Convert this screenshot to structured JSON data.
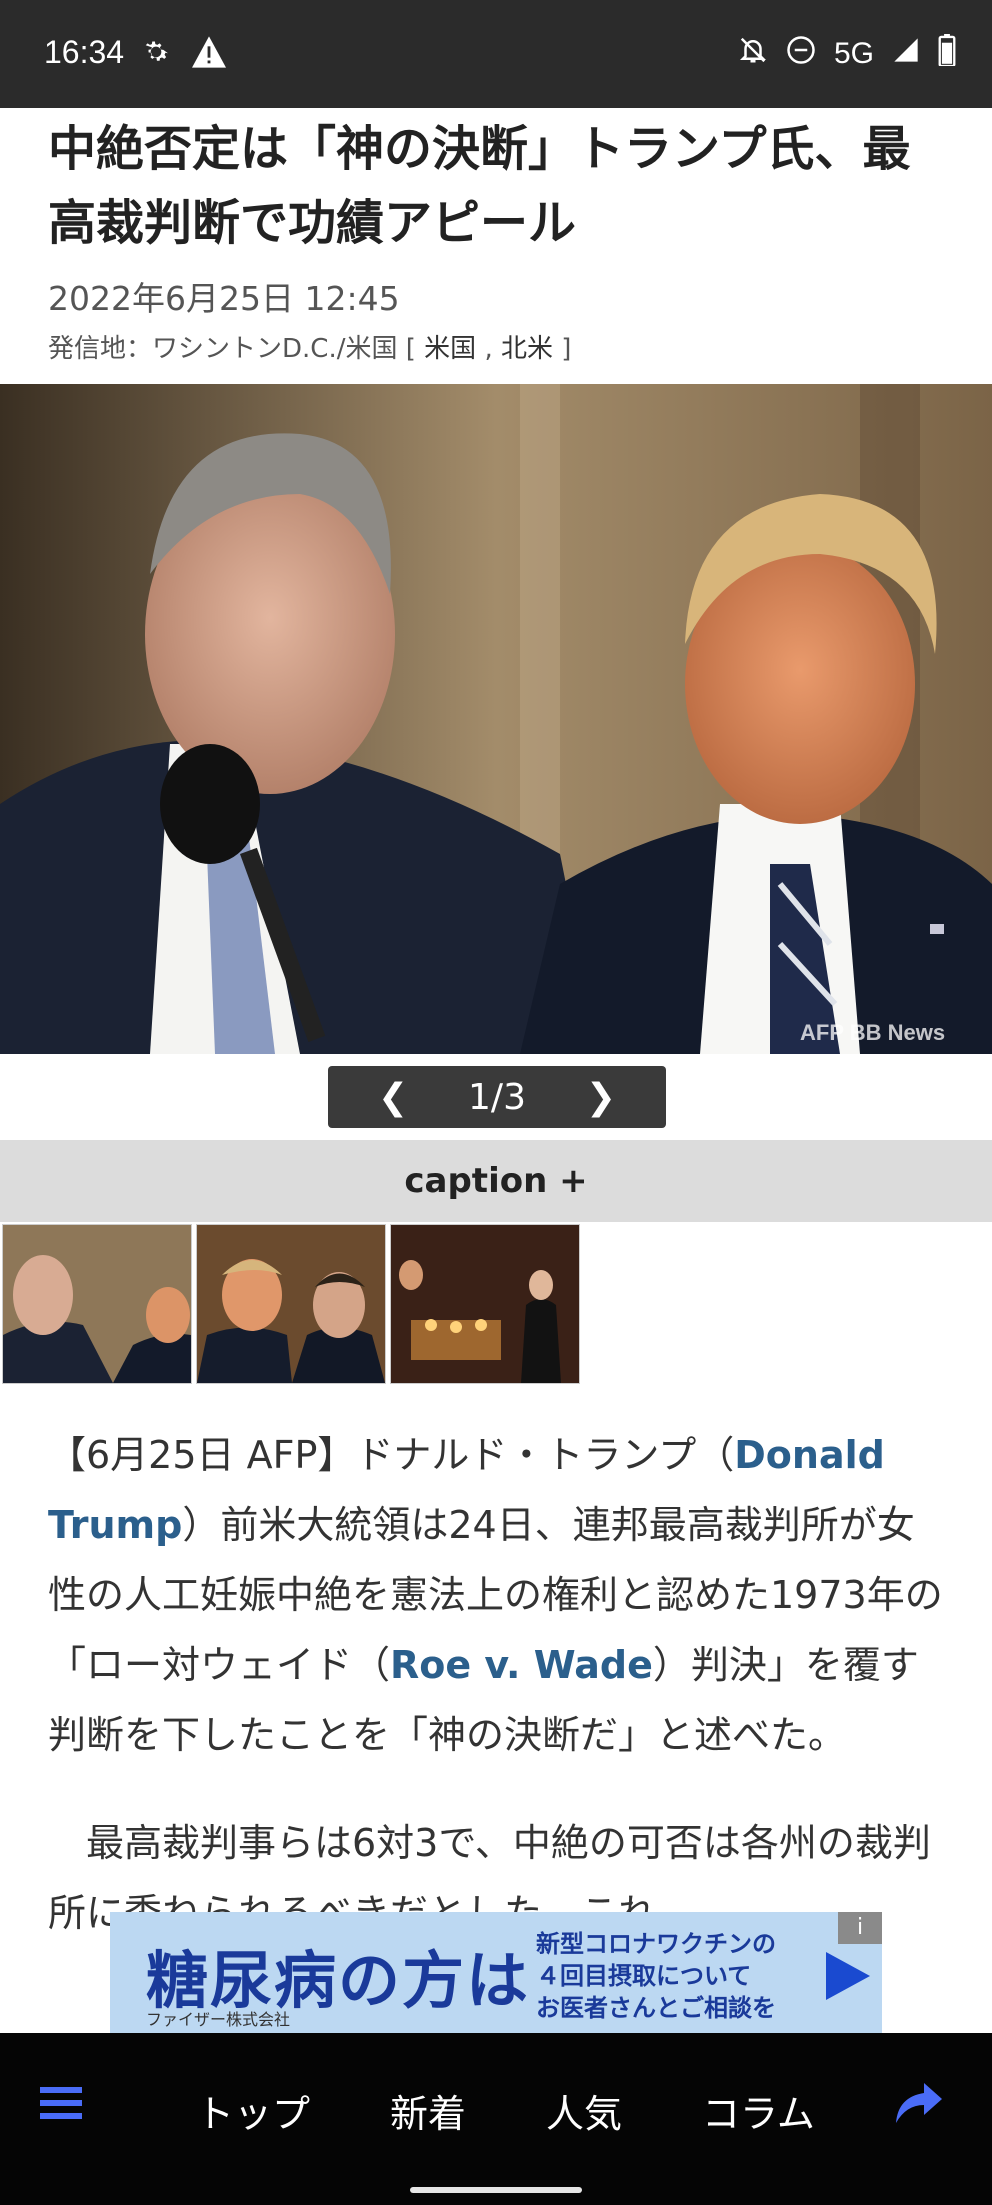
{
  "status_bar": {
    "time": "16:34",
    "network": "5G",
    "icons": [
      "gear-icon",
      "warning-icon",
      "bell-off-icon",
      "do-not-disturb-icon",
      "signal-icon",
      "battery-icon"
    ]
  },
  "article": {
    "title": "中絶否定は「神の決断」トランプ氏、最高裁判断で功績アピール",
    "date": "2022年6月25日 12:45",
    "dateline_prefix": "発信地：ワシントンD.C./米国",
    "tag_open": "[",
    "tag1": "米国",
    "tag_sep": ",",
    "tag2": "北米",
    "tag_close": "]",
    "photo_credit": "AFP BB News",
    "pager": {
      "prev": "❮",
      "current": "1/3",
      "next": "❯"
    },
    "caption_toggle": "caption +",
    "p1": {
      "a": "【6月25日 AFP】ドナルド・トランプ（",
      "link1": "Donald Trump",
      "b": "）前米大統領は24日、連邦最高裁判所が女性の人工妊娠中絶を憲法上の権利と認めた1973年の「ロー対ウェイド（",
      "link2": "Roe v. Wade",
      "c": "）判決」を覆す判断を下したことを「神の決断だ」と述べた。"
    },
    "p2": "　最高裁判事らは6対3で、中絶の可否は各州の裁判所に委ねられるべきだとした。これ"
  },
  "ad": {
    "main": "糖尿病の方は",
    "sub": "ファイザー株式会社",
    "side_line1": "新型コロナワクチンの",
    "side_line2": "４回目摂取について",
    "side_line3": "お医者さんとご相談を",
    "info": "i"
  },
  "bottom_nav": {
    "menu_icon": "menu-icon",
    "items": [
      "トップ",
      "新着",
      "人気",
      "コラム"
    ],
    "share_icon": "share-icon"
  },
  "colors": {
    "link": "#2b5f8c",
    "nav_accent": "#4a6cf7",
    "ad_bg": "#bcd8f2"
  }
}
